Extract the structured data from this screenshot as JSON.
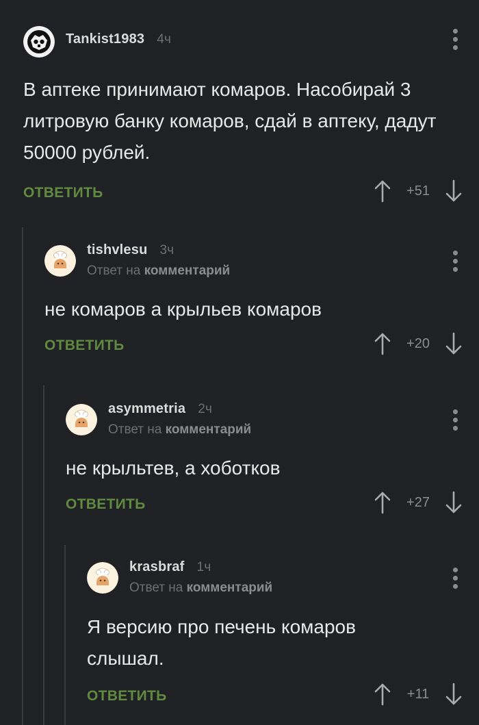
{
  "comments": [
    {
      "username": "Tankist1983",
      "time": "4ч",
      "avatar_icon": "tank-emblem-icon",
      "reply_prefix": "",
      "reply_target": "",
      "text": "В аптеке принимают комаров. Насобирай 3 литровую банку комаров, сдай в аптеку, дадут 50000 рублей.",
      "reply_label": "ОТВЕТИТЬ",
      "rating": "+51"
    },
    {
      "username": "tishvlesu",
      "time": "3ч",
      "avatar_icon": "chef-avatar-icon",
      "reply_prefix": "Ответ на",
      "reply_target": "комментарий",
      "text": "не комаров а крыльев комаров",
      "reply_label": "ОТВЕТИТЬ",
      "rating": "+20"
    },
    {
      "username": "asymmetria",
      "time": "2ч",
      "avatar_icon": "chef-avatar-icon",
      "reply_prefix": "Ответ на",
      "reply_target": "комментарий",
      "text": "не крыльтев, а хоботков",
      "reply_label": "ОТВЕТИТЬ",
      "rating": "+27"
    },
    {
      "username": "krasbraf",
      "time": "1ч",
      "avatar_icon": "chef-avatar-icon",
      "reply_prefix": "Ответ на",
      "reply_target": "комментарий",
      "text": "Я версию про печень комаров слышал.",
      "reply_label": "ОТВЕТИТЬ",
      "rating": "+11"
    }
  ],
  "icons": {
    "more": "more-vertical-icon",
    "upvote": "arrow-up-icon",
    "downvote": "arrow-down-icon"
  },
  "colors": {
    "background": "#202124",
    "reply_button": "#5f8a3f",
    "muted_text": "#6d6f73",
    "thread_line": "#3a3b3e"
  }
}
